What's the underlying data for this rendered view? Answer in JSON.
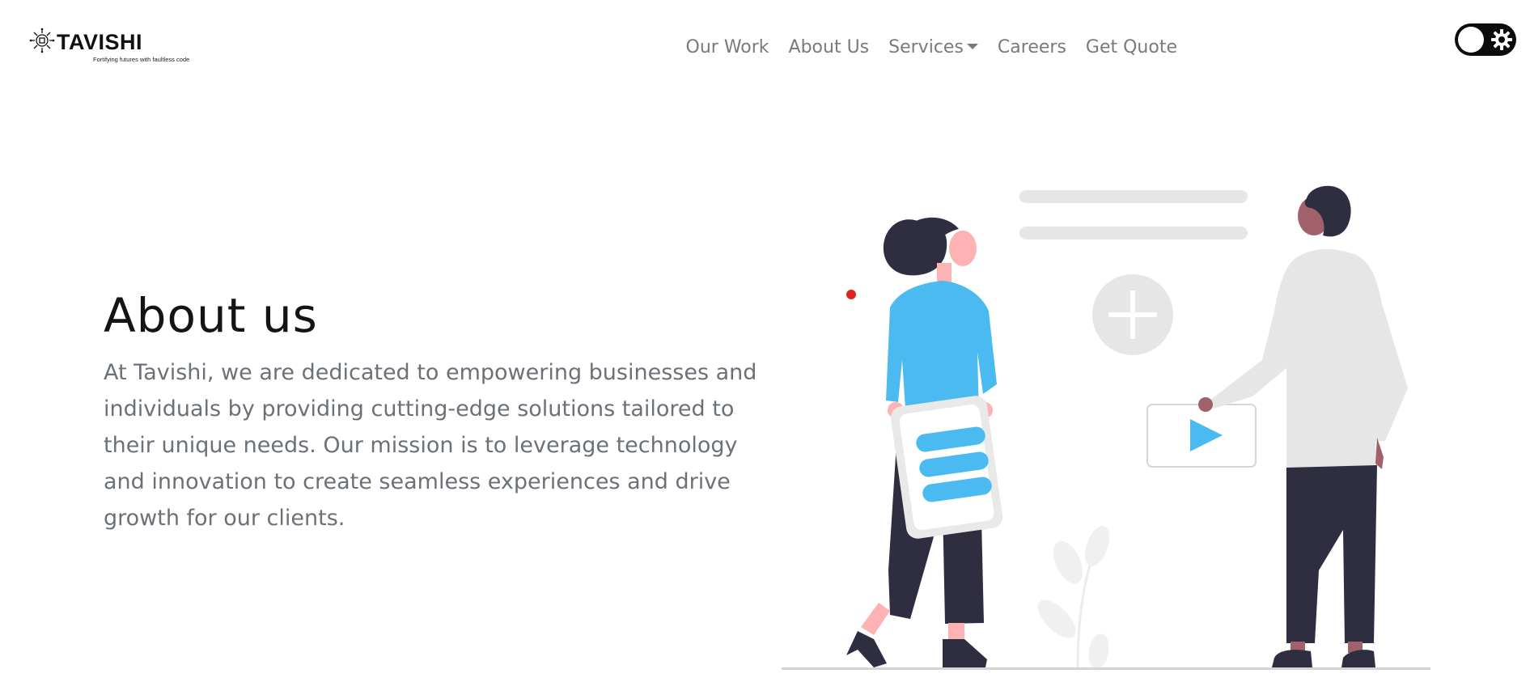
{
  "header": {
    "brand": {
      "name": "TAVISHI",
      "tagline": "Fortifying futures with faultless code",
      "icon": "gear-logo-icon"
    },
    "nav": {
      "our_work": "Our Work",
      "about_us": "About Us",
      "services": "Services",
      "careers": "Careers",
      "get_quote": "Get Quote"
    },
    "theme_toggle": {
      "state": "dark-mode-off",
      "icon": "gear-icon"
    }
  },
  "hero": {
    "title": "About us",
    "body": "At Tavishi, we are dedicated to empowering businesses and individuals by providing cutting-edge solutions tailored to their unique needs. Our mission is to leverage technology and innovation to create seamless experiences and drive growth for our clients."
  },
  "colors": {
    "accent_blue": "#4bbaf0",
    "dark_navy": "#2f2e41",
    "light_gray": "#e6e6e6",
    "skin_light": "#fdb3b3",
    "skin_dark": "#a0616a",
    "red_dot": "#e02424"
  }
}
